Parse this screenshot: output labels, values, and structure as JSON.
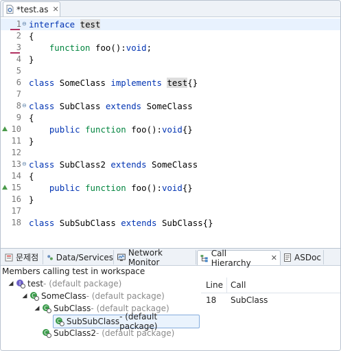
{
  "editor": {
    "tab_label": "*test.as",
    "lines": [
      {
        "n": "1",
        "segs": [
          {
            "t": "interface",
            "c": "kw"
          },
          {
            "t": " "
          },
          {
            "t": "test",
            "c": "hl"
          }
        ]
      },
      {
        "n": "2",
        "segs": [
          {
            "t": "{"
          }
        ]
      },
      {
        "n": "3",
        "segs": [
          {
            "t": "    "
          },
          {
            "t": "function",
            "c": "kw2"
          },
          {
            "t": " foo():"
          },
          {
            "t": "void",
            "c": "kw"
          },
          {
            "t": ";"
          }
        ]
      },
      {
        "n": "4",
        "segs": [
          {
            "t": "}"
          }
        ]
      },
      {
        "n": "5",
        "segs": []
      },
      {
        "n": "6",
        "segs": [
          {
            "t": "class",
            "c": "kw"
          },
          {
            "t": " SomeClass "
          },
          {
            "t": "implements",
            "c": "kw"
          },
          {
            "t": " "
          },
          {
            "t": "test",
            "c": "hl"
          },
          {
            "t": "{}"
          }
        ]
      },
      {
        "n": "7",
        "segs": []
      },
      {
        "n": "8",
        "segs": [
          {
            "t": "class",
            "c": "kw"
          },
          {
            "t": " SubClass "
          },
          {
            "t": "extends",
            "c": "kw"
          },
          {
            "t": " SomeClass"
          }
        ]
      },
      {
        "n": "9",
        "segs": [
          {
            "t": "{"
          }
        ]
      },
      {
        "n": "10",
        "segs": [
          {
            "t": "    "
          },
          {
            "t": "public",
            "c": "kw"
          },
          {
            "t": " "
          },
          {
            "t": "function",
            "c": "kw2"
          },
          {
            "t": " foo():"
          },
          {
            "t": "void",
            "c": "kw"
          },
          {
            "t": "{}"
          }
        ]
      },
      {
        "n": "11",
        "segs": [
          {
            "t": "}"
          }
        ]
      },
      {
        "n": "12",
        "segs": []
      },
      {
        "n": "13",
        "segs": [
          {
            "t": "class",
            "c": "kw"
          },
          {
            "t": " SubClass2 "
          },
          {
            "t": "extends",
            "c": "kw"
          },
          {
            "t": " SomeClass"
          }
        ]
      },
      {
        "n": "14",
        "segs": [
          {
            "t": "{"
          }
        ]
      },
      {
        "n": "15",
        "segs": [
          {
            "t": "    "
          },
          {
            "t": "public",
            "c": "kw"
          },
          {
            "t": " "
          },
          {
            "t": "function",
            "c": "kw2"
          },
          {
            "t": " foo():"
          },
          {
            "t": "void",
            "c": "kw"
          },
          {
            "t": "{}"
          }
        ]
      },
      {
        "n": "16",
        "segs": [
          {
            "t": "}"
          }
        ]
      },
      {
        "n": "17",
        "segs": []
      },
      {
        "n": "18",
        "segs": [
          {
            "t": "class",
            "c": "kw"
          },
          {
            "t": " SubSubClass "
          },
          {
            "t": "extends",
            "c": "kw"
          },
          {
            "t": " SubClass{}"
          }
        ]
      }
    ]
  },
  "panel": {
    "tabs": {
      "problems": "문제점",
      "data_services": "Data/Services",
      "network_monitor": "Network Monitor",
      "call_hierarchy": "Call Hierarchy",
      "asdoc": "ASDoc"
    },
    "status": "Members calling test in workspace",
    "tree": {
      "root": {
        "name": "test",
        "pkg": " - (default package)"
      },
      "someclass": {
        "name": "SomeClass",
        "pkg": " - (default package)"
      },
      "subclass": {
        "name": "SubClass",
        "pkg": " - (default package)"
      },
      "subsubclass": {
        "name": "SubSubClass",
        "pkg": " - (default package)"
      },
      "subclass2": {
        "name": "SubClass2",
        "pkg": " - (default package)"
      }
    },
    "locations": {
      "col_line": "Line",
      "col_call": "Call",
      "rows": [
        {
          "line": "18",
          "call": "SubClass"
        }
      ]
    }
  },
  "colors": {
    "keyword": "#0033b3",
    "function_keyword": "#00843e",
    "current_line": "#e8f2fe",
    "highlight": "#dedede"
  }
}
